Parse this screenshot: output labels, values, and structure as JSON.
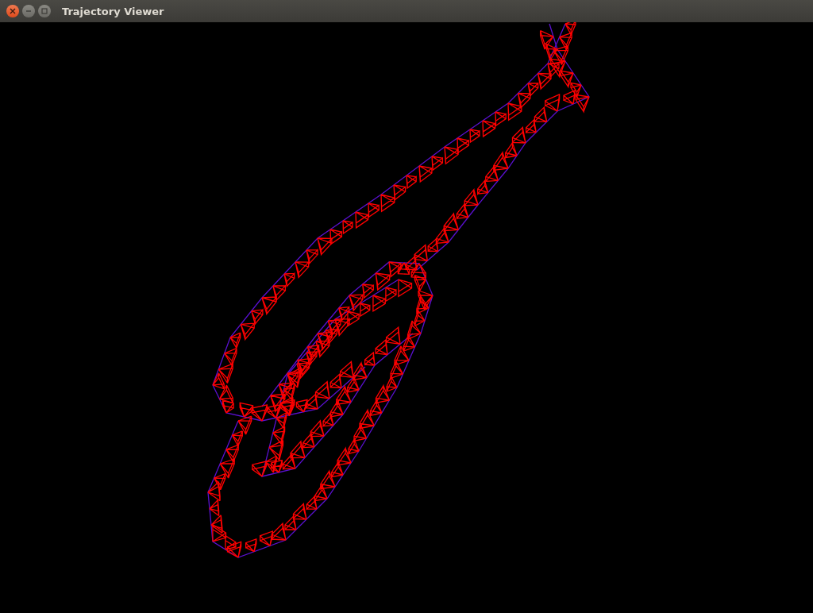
{
  "window": {
    "title": "Trajectory Viewer"
  }
}
